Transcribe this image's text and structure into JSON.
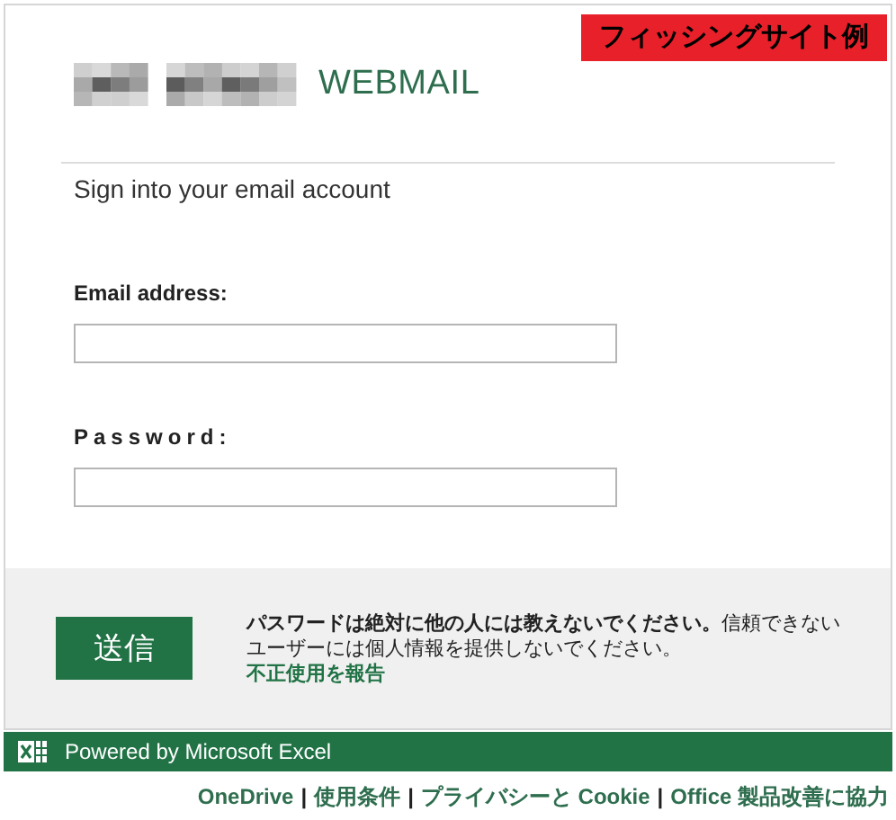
{
  "badge": "フィッシングサイト例",
  "header": {
    "title": "WEBMAIL"
  },
  "subtitle": "Sign into your email account",
  "fields": [
    {
      "label": "Email address:",
      "kind": "plain"
    },
    {
      "label": "Password:",
      "kind": "spaced"
    }
  ],
  "submit_button": "送信",
  "warning": {
    "text": "**パスワードは絶対に他の人には教えないでください。**信頼できないユーザーには個人情報を提供しないでください。",
    "link": "不正使用を報告"
  },
  "powered_by": "Powered by Microsoft Excel",
  "footer_links": [
    {
      "kind": "link",
      "text": "OneDrive"
    },
    {
      "kind": "separator",
      "text": "|"
    },
    {
      "kind": "link",
      "text": "使用条件"
    },
    {
      "kind": "separator",
      "text": "|"
    },
    {
      "kind": "link",
      "text": "プライバシーと Cookie"
    },
    {
      "kind": "separator",
      "text": "|"
    },
    {
      "kind": "link",
      "text": "Office 製品改善に協力"
    }
  ]
}
